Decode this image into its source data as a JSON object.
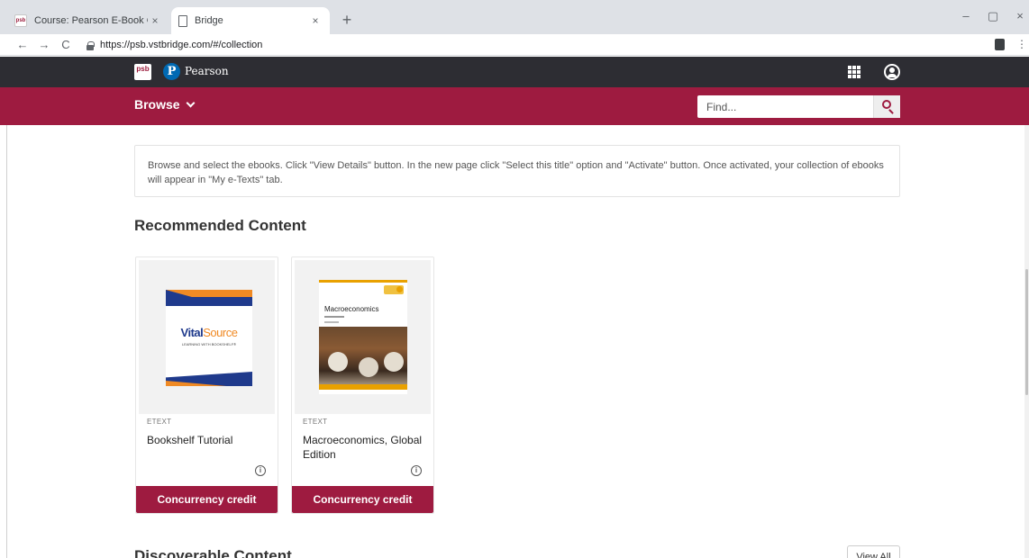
{
  "browser": {
    "tabs": [
      {
        "label": "Course: Pearson E-Book Collectio",
        "favicon": "psb-icon",
        "favicon_text": "psb",
        "active": false
      },
      {
        "label": "Bridge",
        "favicon": "document-icon",
        "active": true
      }
    ],
    "tab_close_glyph": "×",
    "new_tab_glyph": "+",
    "window_controls": {
      "minimize": "–",
      "restore": "▢",
      "close": "×"
    },
    "nav": {
      "back": "←",
      "forward": "→",
      "reload": "C"
    },
    "url": "https://psb.vstbridge.com/#/collection",
    "menu_glyph": "⋮"
  },
  "header": {
    "psb_logo_text": "psb",
    "pearson_badge": "P",
    "pearson_name": "Pearson"
  },
  "subnav": {
    "browse_label": "Browse",
    "find_placeholder": "Find..."
  },
  "notice": {
    "text": "Browse and select the ebooks. Click \"View Details\" button. In the new page click \"Select this title\" option and \"Activate\" button. Once activated, your collection of ebooks will appear in \"My e-Texts\" tab."
  },
  "recommended": {
    "title": "Recommended Content",
    "cards": [
      {
        "type_label": "ETEXT",
        "title": "Bookshelf Tutorial",
        "cover_brand_a": "Vital",
        "cover_brand_b": "Source",
        "cover_sub": "LEARNING WITH BOOKSHELF®",
        "info_glyph": "i",
        "button": "Concurrency credit"
      },
      {
        "type_label": "ETEXT",
        "title": "Macroeconomics, Global Edition",
        "cover_title": "Macroeconomics",
        "info_glyph": "i",
        "button": "Concurrency credit"
      }
    ]
  },
  "discoverable": {
    "title": "Discoverable Content",
    "view_all": "View All"
  },
  "colors": {
    "brand_crimson": "#9e1b40",
    "topbar_dark": "#2d2d33",
    "pearson_blue": "#0069b3"
  }
}
